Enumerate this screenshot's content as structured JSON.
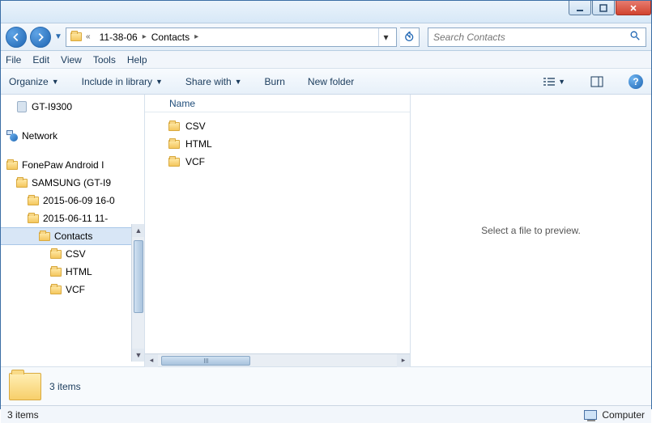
{
  "titlebar": {},
  "nav": {
    "breadcrumb": {
      "blurred": "",
      "seg1": "11-38-06",
      "seg2": "Contacts"
    },
    "search_placeholder": "Search Contacts"
  },
  "menu": {
    "file": "File",
    "edit": "Edit",
    "view": "View",
    "tools": "Tools",
    "help": "Help"
  },
  "toolbar": {
    "organize": "Organize",
    "include_library": "Include in library",
    "share_with": "Share with",
    "burn": "Burn",
    "new_folder": "New folder"
  },
  "tree": {
    "device": "GT-I9300",
    "network": "Network",
    "app": "FonePaw Android I",
    "samsung": "SAMSUNG (GT-I9",
    "date1": "2015-06-09 16-0",
    "date2": "2015-06-11 11-",
    "contacts": "Contacts",
    "csv": "CSV",
    "html": "HTML",
    "vcf": "VCF"
  },
  "list": {
    "col_name": "Name",
    "items": [
      "CSV",
      "HTML",
      "VCF"
    ]
  },
  "preview": {
    "placeholder": "Select a file to preview."
  },
  "details": {
    "summary": "3 items"
  },
  "status": {
    "left": "3 items",
    "right": "Computer"
  }
}
